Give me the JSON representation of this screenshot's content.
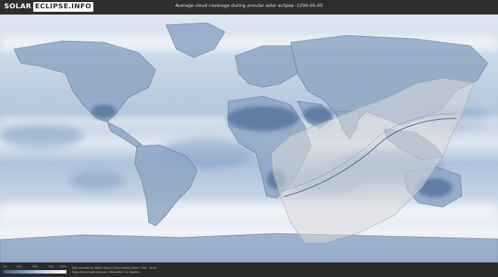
{
  "header": {
    "logo_left": "SOLAR",
    "logo_right": "ECLIPSE.INFO",
    "title": "Average cloud coverage during annular solar eclipse -1290-05-05"
  },
  "legend": {
    "ticks": [
      "0%",
      "25%",
      "50%",
      "75%",
      "100%"
    ],
    "tick_fractions": [
      0,
      0.25,
      0.5,
      0.75,
      1.0
    ],
    "colors": [
      "#3d5f8e",
      "#7f9dc1",
      "#c9d7e7",
      "#ffffff"
    ]
  },
  "footer": {
    "credit_line1": "Data provided by NASA's Aqua & Terra satellite (Years: 2000 - 2019)",
    "credit_line2": "https://neo.sci.gsfc.nasa.gov | Resolution: 0.1 degrees"
  },
  "colors": {
    "ocean_clear": "#6f8fb7",
    "cloudy": "#e6ecf4",
    "land_outline": "#4a5a72",
    "eclipse_zone": "#d8d8d8",
    "eclipse_path": "#45556a"
  }
}
